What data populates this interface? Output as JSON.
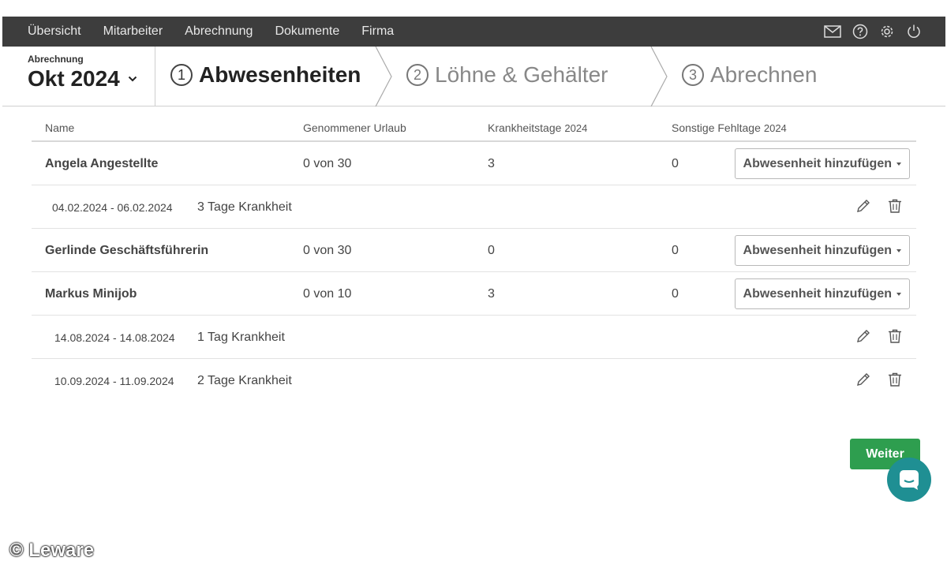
{
  "nav": {
    "items": [
      "Übersicht",
      "Mitarbeiter",
      "Abrechnung",
      "Dokumente",
      "Firma"
    ],
    "icons": [
      "mail-icon",
      "help-icon",
      "gear-icon",
      "power-icon"
    ]
  },
  "period": {
    "label": "Abrechnung",
    "value": "Okt 2024"
  },
  "steps": [
    {
      "num": "1",
      "label": "Abwesenheiten"
    },
    {
      "num": "2",
      "label": "Löhne & Gehälter"
    },
    {
      "num": "3",
      "label": "Abrechnen"
    }
  ],
  "table": {
    "headers": {
      "name": "Name",
      "urlaub": "Genommener Urlaub",
      "krank": "Krankheitstage",
      "krank_year": "2024",
      "sonstige": "Sonstige Fehltage",
      "sonstige_year": "2024"
    },
    "add_label": "Abwesenheit hinzufügen",
    "employees": [
      {
        "name": "Angela Angestellte",
        "urlaub": "0 von 30",
        "krank": "3",
        "sonstige": "0"
      },
      {
        "name": "Gerlinde Geschäftsführerin",
        "urlaub": "0 von 30",
        "krank": "0",
        "sonstige": "0"
      },
      {
        "name": "Markus Minijob",
        "urlaub": "0 von 10",
        "krank": "3",
        "sonstige": "0"
      }
    ],
    "absences": [
      {
        "range": "04.02.2024 - 06.02.2024",
        "desc": "3 Tage Krankheit"
      },
      {
        "range": "14.08.2024 - 14.08.2024",
        "desc": "1 Tag Krankheit"
      },
      {
        "range": "10.09.2024 - 11.09.2024",
        "desc": "2 Tage Krankheit"
      }
    ]
  },
  "weiter_label": "Weiter",
  "watermark": "© Leware",
  "colors": {
    "nav_bg": "#3d3d3d",
    "primary_green": "#2e9e4f",
    "chat_teal": "#1f8f93"
  }
}
